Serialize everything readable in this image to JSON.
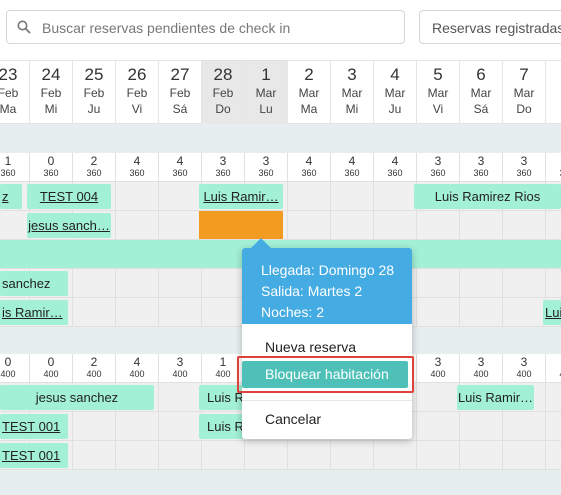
{
  "search": {
    "placeholder": "Buscar reservas pendientes de check in"
  },
  "registered_select": {
    "label": "Reservas registradas"
  },
  "dates": [
    {
      "num": "23",
      "mon": "Feb",
      "day": "Ma"
    },
    {
      "num": "24",
      "mon": "Feb",
      "day": "Mi"
    },
    {
      "num": "25",
      "mon": "Feb",
      "day": "Ju"
    },
    {
      "num": "26",
      "mon": "Feb",
      "day": "Vi"
    },
    {
      "num": "27",
      "mon": "Feb",
      "day": "Sá"
    },
    {
      "num": "28",
      "mon": "Feb",
      "day": "Do"
    },
    {
      "num": "1",
      "mon": "Mar",
      "day": "Lu"
    },
    {
      "num": "2",
      "mon": "Mar",
      "day": "Ma"
    },
    {
      "num": "3",
      "mon": "Mar",
      "day": "Mi"
    },
    {
      "num": "4",
      "mon": "Mar",
      "day": "Ju"
    },
    {
      "num": "5",
      "mon": "Mar",
      "day": "Vi"
    },
    {
      "num": "6",
      "mon": "Mar",
      "day": "Sá"
    },
    {
      "num": "7",
      "mon": "Mar",
      "day": "Do"
    },
    {
      "num": "",
      "mon": "M",
      "day": ""
    }
  ],
  "availability_top": {
    "counts": [
      "1",
      "0",
      "2",
      "4",
      "4",
      "3",
      "3",
      "4",
      "4",
      "4",
      "3",
      "3",
      "3",
      "3"
    ],
    "prices": [
      "360",
      "360",
      "360",
      "360",
      "360",
      "360",
      "360",
      "360",
      "360",
      "360",
      "360",
      "360",
      "360",
      "360"
    ]
  },
  "availability_bottom": {
    "counts": [
      "0",
      "0",
      "2",
      "4",
      "3",
      "1",
      "",
      "",
      "",
      "",
      "3",
      "3",
      "3",
      "3"
    ],
    "prices": [
      "400",
      "400",
      "400",
      "400",
      "400",
      "400",
      "",
      "",
      "",
      "",
      "400",
      "400",
      "400",
      "400"
    ]
  },
  "reservations": {
    "r1": "z",
    "r2": "TEST 004",
    "r3": "Luis Ramir…",
    "r4": "Luis Ramirez Rios",
    "r5": "jesus sanch…",
    "r6": "sanchez",
    "r7": "is Ramir…",
    "r8": "Lui",
    "r9": "jesus sanchez",
    "r10": "Luis R",
    "r11": "Luis Ramir…",
    "r12": "TEST 001",
    "r13": "Luis R",
    "r14": "TEST 001"
  },
  "popup": {
    "arrival": "Llegada: Domingo 28",
    "departure": "Salida: Martes 2",
    "nights": "Noches: 2",
    "new_reservation": "Nueva reserva",
    "block_room": "Bloquear habitación",
    "cancel": "Cancelar"
  },
  "colors": {
    "reservation": "#a2f0d6",
    "blocked": "#f39a20",
    "popup_header": "#45abe3",
    "block_button": "#4ec0b8",
    "highlight_frame": "#e0403a"
  }
}
